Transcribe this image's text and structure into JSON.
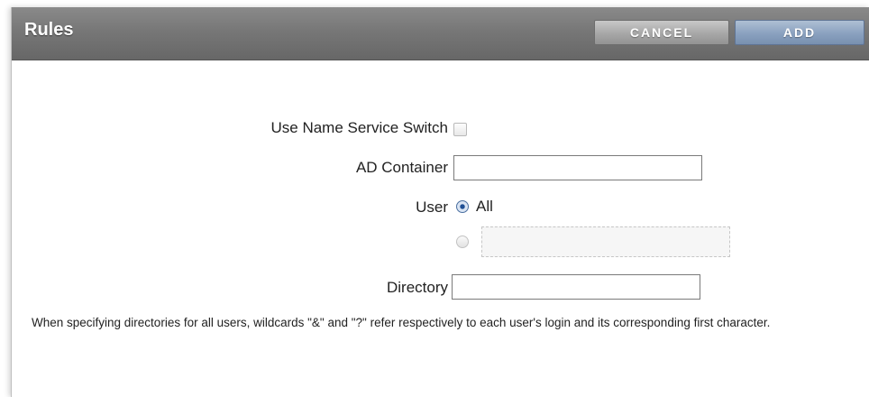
{
  "dialog": {
    "title": "Rules",
    "cancel_label": "CANCEL",
    "add_label": "ADD"
  },
  "form": {
    "name_service_switch": {
      "label": "Use Name Service Switch",
      "checked": false
    },
    "ad_container": {
      "label": "AD Container",
      "value": ""
    },
    "user": {
      "label": "User",
      "option_all_label": "All",
      "selected": "All",
      "custom_value": ""
    },
    "directory": {
      "label": "Directory",
      "value": ""
    },
    "note": "When specifying directories for all users, wildcards \"&\" and \"?\" refer respectively to each user's login and its corresponding first character."
  }
}
